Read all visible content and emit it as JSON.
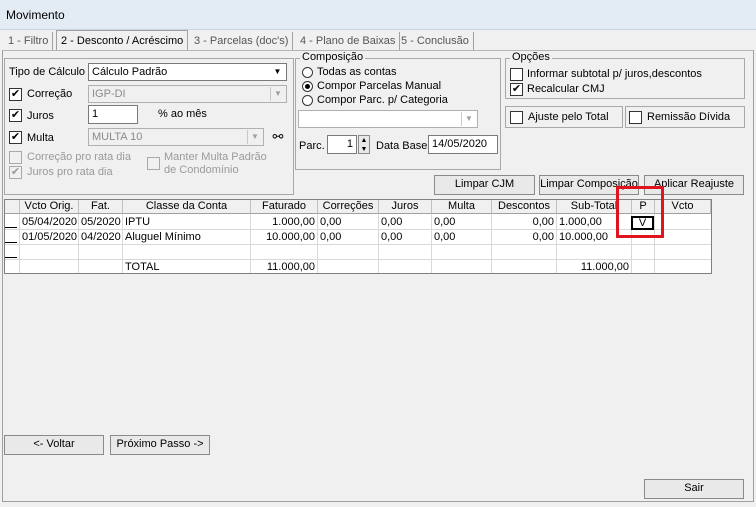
{
  "window": {
    "title": "Movimento"
  },
  "tabs": [
    {
      "label": "1 - Filtro"
    },
    {
      "label": "2 - Desconto / Acréscimo"
    },
    {
      "label": "3 - Parcelas (doc's)"
    },
    {
      "label": "4 - Plano de Baixas"
    },
    {
      "label": "5 - Conclusão"
    }
  ],
  "calc": {
    "tipo_label": "Tipo de Cálculo",
    "tipo_value": "Cálculo Padrão",
    "correcao_label": "Correção",
    "correcao_value": "IGP-DI",
    "juros_label": "Juros",
    "juros_value": "1",
    "juros_unit": "% ao mês",
    "multa_label": "Multa",
    "multa_value": "MULTA 10",
    "correcao_pro_rata": "Correção pro rata dia",
    "juros_pro_rata": "Juros pro rata dia",
    "manter_multa_1": "Manter Multa Padrão",
    "manter_multa_2": "de Condomínio"
  },
  "composicao": {
    "title": "Composição",
    "opt1": "Todas as contas",
    "opt2": "Compor Parcelas Manual",
    "opt3": "Compor Parc. p/ Categoria",
    "parc_label": "Parc.",
    "parc_value": "1",
    "data_base_label": "Data Base",
    "data_base_value": "14/05/2020"
  },
  "opcoes": {
    "title": "Opções",
    "informar": "Informar subtotal p/ juros,descontos",
    "recalcular": "Recalcular CMJ",
    "ajuste": "Ajuste pelo Total",
    "remissao": "Remissão Dívida"
  },
  "buttons": {
    "limpar_cjm": "Limpar CJM",
    "limpar_comp": "Limpar Composição",
    "aplicar": "Aplicar Reajuste",
    "voltar": "<- Voltar",
    "proximo": "Próximo Passo ->",
    "sair": "Sair"
  },
  "grid": {
    "headers": [
      "Vcto Orig.",
      "Fat.",
      "Classe da Conta",
      "Faturado",
      "Correções",
      "Juros",
      "Multa",
      "Descontos",
      "Sub-Total",
      "P",
      "Vcto"
    ],
    "rows": [
      [
        "05/04/2020",
        "05/2020",
        "IPTU",
        "1.000,00",
        "0,00",
        "0,00",
        "0,00",
        "0,00",
        "1.000,00",
        "V",
        ""
      ],
      [
        "01/05/2020",
        "04/2020",
        "Aluguel Mínimo",
        "10.000,00",
        "0,00",
        "0,00",
        "0,00",
        "0,00",
        "10.000,00",
        "",
        ""
      ]
    ],
    "total_label": "TOTAL",
    "total_faturado": "11.000,00",
    "total_subtotal": "11.000,00"
  }
}
